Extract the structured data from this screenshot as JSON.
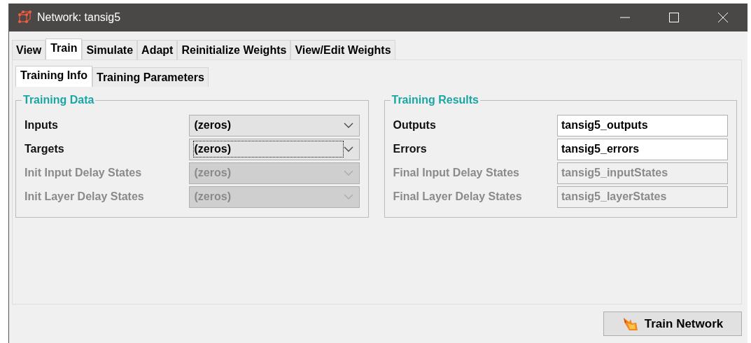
{
  "window": {
    "title": "Network: tansig5"
  },
  "tabs": [
    {
      "label": "View",
      "selected": false
    },
    {
      "label": "Train",
      "selected": true
    },
    {
      "label": "Simulate",
      "selected": false
    },
    {
      "label": "Adapt",
      "selected": false
    },
    {
      "label": "Reinitialize Weights",
      "selected": false
    },
    {
      "label": "View/Edit Weights",
      "selected": false
    }
  ],
  "subtabs": [
    {
      "label": "Training Info",
      "selected": true
    },
    {
      "label": "Training Parameters",
      "selected": false
    }
  ],
  "training_data": {
    "title": "Training Data",
    "rows": [
      {
        "label": "Inputs",
        "value": "(zeros)",
        "disabled": false,
        "focused": false
      },
      {
        "label": "Targets",
        "value": "(zeros)",
        "disabled": false,
        "focused": true
      },
      {
        "label": "Init Input Delay States",
        "value": "(zeros)",
        "disabled": true,
        "focused": false
      },
      {
        "label": "Init Layer Delay States",
        "value": "(zeros)",
        "disabled": true,
        "focused": false
      }
    ]
  },
  "training_results": {
    "title": "Training Results",
    "rows": [
      {
        "label": "Outputs",
        "value": "tansig5_outputs",
        "disabled": false
      },
      {
        "label": "Errors",
        "value": "tansig5_errors",
        "disabled": false
      },
      {
        "label": "Final Input Delay States",
        "value": "tansig5_inputStates",
        "disabled": true
      },
      {
        "label": "Final Layer Delay States",
        "value": "tansig5_layerStates",
        "disabled": true
      }
    ]
  },
  "train_button": {
    "label": "Train Network"
  }
}
